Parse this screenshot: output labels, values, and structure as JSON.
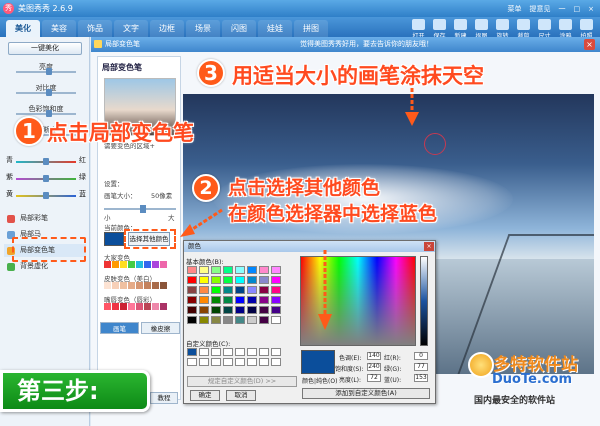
{
  "window": {
    "title": "美图秀秀 2.6.9",
    "title_right": [
      "菜单",
      "提意见",
      "一",
      "□",
      "×"
    ]
  },
  "nav": {
    "tabs": [
      "美化",
      "美容",
      "饰品",
      "文字",
      "边框",
      "场景",
      "闪图",
      "娃娃",
      "拼图"
    ],
    "active_tab": "美化",
    "tools": [
      "打开",
      "保存",
      "新建",
      "抠图",
      "旋转",
      "裁剪",
      "尺寸",
      "涂鸦",
      "拍照"
    ]
  },
  "left_panel": {
    "beautify_button": "一键美化",
    "adjust_labels": [
      "亮度",
      "对比度",
      "色彩饱和度",
      "清晰度"
    ],
    "color_rows": [
      {
        "left": "青",
        "right": "红"
      },
      {
        "left": "紫",
        "right": "绿"
      },
      {
        "left": "黄",
        "right": "蓝"
      }
    ],
    "tools": [
      "局部彩笔",
      "局部马",
      "局部变色笔",
      "背景虚化"
    ]
  },
  "dialog": {
    "title": "局部变色笔",
    "hint": "觉得美图秀秀好用，要去告诉你的朋友哦！",
    "close": "×"
  },
  "tool_panel": {
    "title": "局部变色笔",
    "desc": "需要变色的区域+",
    "settings_label": "设置：",
    "brush_size_label": "画笔大小：",
    "brush_size_value": "50像素",
    "small": "小",
    "big": "大",
    "current_color_label": "当前颜色：",
    "select_other_color": "选择其他颜色",
    "color_group_1": "大家变色",
    "color_group_2": "皮肤变色（美白）",
    "color_group_3": "嘴唇变色（唇彩）",
    "tab_brush": "画笔",
    "tab_eraser": "橡皮擦",
    "tutorial": "教程"
  },
  "color_dialog": {
    "title": "颜色",
    "basic_colors": "基本颜色(B):",
    "custom_colors": "自定义颜色(C):",
    "define_custom": "规定自定义颜色(D) >>",
    "ok": "确定",
    "cancel": "取消",
    "preview_label": "颜色|纯色(O)",
    "hue_label": "色调(E):",
    "hue": "140",
    "sat_label": "饱和度(S):",
    "sat": "240",
    "lum_label": "亮度(L):",
    "lum": "72",
    "red_label": "红(R):",
    "red": "0",
    "green_label": "绿(G):",
    "green": "77",
    "blue_label": "蓝(U):",
    "blue": "153",
    "add_custom": "添加到自定义颜色(A)"
  },
  "annotations": {
    "step1_num": "1",
    "step1": "点击局部变色笔",
    "step2_num": "2",
    "step2_line1": "点击选择其他颜色",
    "step2_line2": "在颜色选择器中选择蓝色",
    "step3_num": "3",
    "step3": "用适当大小的画笔涂抹天空",
    "step_label": "第三步:"
  },
  "watermark": {
    "logo": "多特软件站",
    "site": "DuoTe.com",
    "tagline": "国内最安全的软件站"
  },
  "colors": {
    "accent": "#ff4a1f",
    "selected_blue": "#0b4e9b",
    "step_green": "#17a021"
  }
}
